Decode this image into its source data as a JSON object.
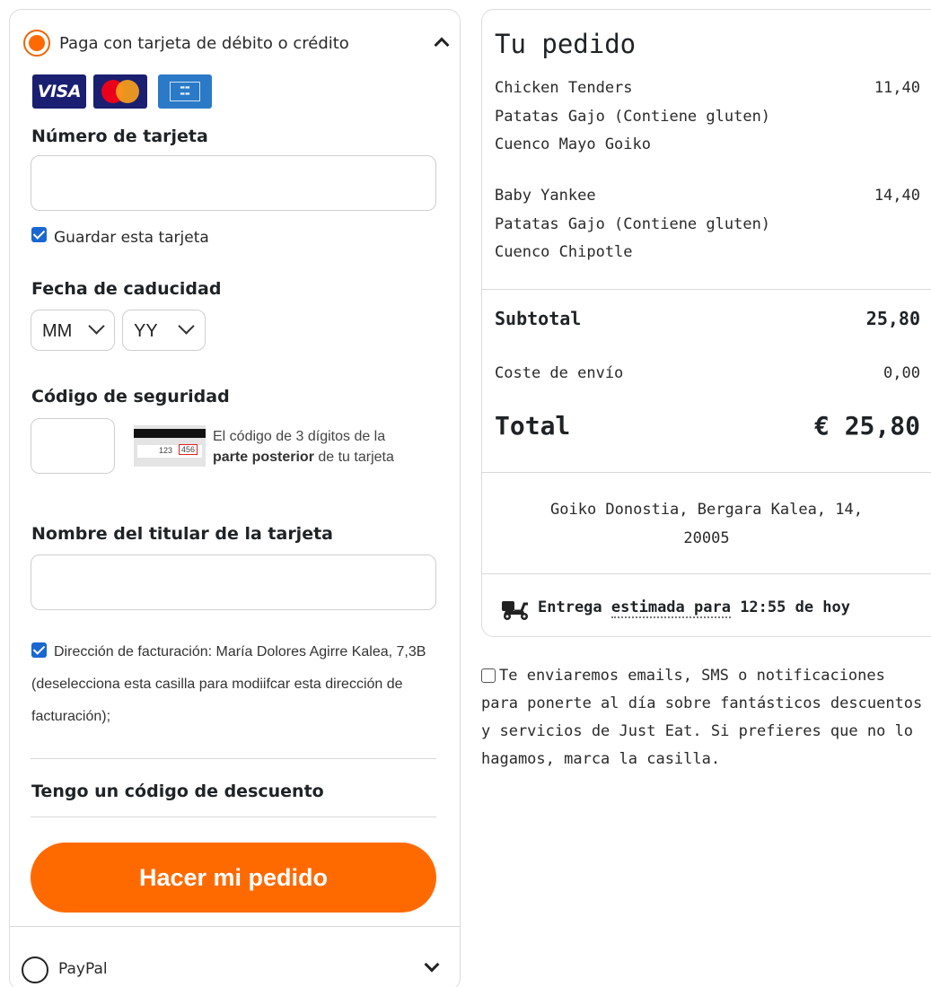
{
  "card_payment": {
    "header_label": "Paga con tarjeta de débito o crédito",
    "card_logos": [
      "VISA",
      "MasterCard",
      "American Express"
    ],
    "visa_text": "VISA",
    "card_number": {
      "label": "Número de tarjeta",
      "value": "",
      "placeholder": ""
    },
    "save_card": {
      "label": "Guardar esta tarjeta",
      "checked": true
    },
    "expiry": {
      "label": "Fecha de caducidad",
      "month_value": "MM",
      "year_value": "YY"
    },
    "security_code": {
      "label": "Código de seguridad",
      "value": "",
      "help_prefix": "El código de 3 dígitos de la ",
      "help_bold": "parte posterior",
      "help_suffix": " de tu tarjeta",
      "card_digits_a": "123",
      "card_digits_b": "456"
    },
    "cardholder": {
      "label": "Nombre del titular de la tarjeta",
      "value": ""
    },
    "billing": {
      "checked": true,
      "text": "Dirección de facturación: María Dolores Agirre Kalea, 7,3B (deselecciona esta casilla para modiifcar esta dirección de facturación);"
    },
    "discount_label": "Tengo un código de descuento",
    "submit_label": "Hacer mi pedido"
  },
  "paypal": {
    "label": "PayPal",
    "selected": false
  },
  "order": {
    "title": "Tu pedido",
    "items": [
      {
        "name": "Chicken Tenders",
        "price": "11,40",
        "options": [
          "Patatas Gajo (Contiene gluten)",
          "Cuenco Mayo Goiko"
        ]
      },
      {
        "name": "Baby Yankee",
        "price": "14,40",
        "options": [
          "Patatas Gajo (Contiene gluten)",
          "Cuenco Chipotle"
        ]
      }
    ],
    "subtotal_label": "Subtotal",
    "subtotal_value": "25,80",
    "delivery_label": "Coste de envío",
    "delivery_value": "0,00",
    "total_label": "Total",
    "total_value": "€ 25,80",
    "restaurant_address": "Goiko Donostia, Bergara Kalea, 14, 20005",
    "delivery_estimate_prefix": "Entrega ",
    "delivery_estimate_dotted": "estimada para",
    "delivery_estimate_suffix": " 12:55 de hoy"
  },
  "marketing_consent": {
    "checked": false,
    "text": "Te enviaremos emails, SMS o notificaciones para ponerte al día sobre fantásticos descuentos y servicios de Just Eat. Si prefieres que no lo hagamos, marca la casilla."
  },
  "colors": {
    "accent": "#ff6a00",
    "checkbox_blue": "#1967d2",
    "border": "#dcdcdc"
  },
  "icons": [
    "chevron-up-icon",
    "chevron-down-icon",
    "delivery-scooter-icon"
  ]
}
